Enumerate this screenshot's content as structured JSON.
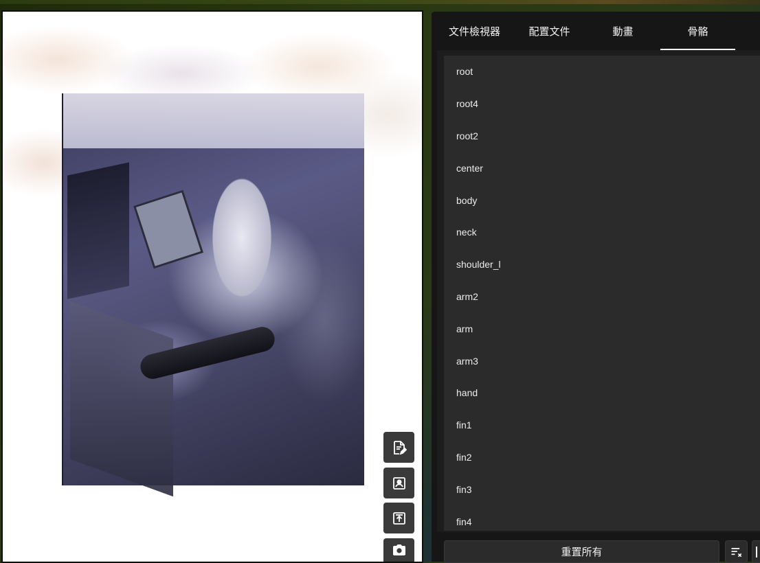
{
  "tabs": [
    {
      "label": "文件檢視器"
    },
    {
      "label": "配置文件"
    },
    {
      "label": "動畫"
    },
    {
      "label": "骨骼",
      "active": true
    }
  ],
  "bones": [
    {
      "label": "root"
    },
    {
      "label": "root4"
    },
    {
      "label": "root2"
    },
    {
      "label": "center"
    },
    {
      "label": "body"
    },
    {
      "label": "neck"
    },
    {
      "label": "shoulder_l"
    },
    {
      "label": "arm2"
    },
    {
      "label": "arm"
    },
    {
      "label": "arm3"
    },
    {
      "label": "hand"
    },
    {
      "label": "fin1"
    },
    {
      "label": "fin2"
    },
    {
      "label": "fin3"
    },
    {
      "label": "fin4"
    }
  ],
  "bottom": {
    "reset_label": "重置所有",
    "clear_sort_icon": "clear-sort-icon"
  },
  "canvas_tools": [
    {
      "icon": "edit-document-icon"
    },
    {
      "icon": "portrait-icon"
    },
    {
      "icon": "export-icon"
    },
    {
      "icon": "camera-icon"
    }
  ],
  "colors": {
    "panel_bg": "#161616",
    "list_bg": "#2b2b2b",
    "tool_bg": "#3a3a3a",
    "active_underline": "#ffffff"
  }
}
